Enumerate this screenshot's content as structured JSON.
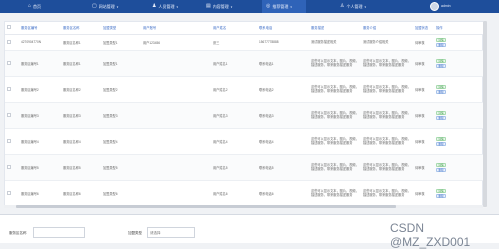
{
  "nav": [
    {
      "icon": "⌂",
      "label": "首页",
      "name": "home",
      "active": false
    },
    {
      "icon": "▢",
      "label": "网站管理",
      "name": "site-manage",
      "active": false
    },
    {
      "icon": "♟",
      "label": "人员管理",
      "name": "people-manage",
      "active": false
    },
    {
      "icon": "▤",
      "label": "内容管理",
      "name": "content-manage",
      "active": false
    },
    {
      "icon": "◎",
      "label": "推荐管理",
      "name": "recommend-manage",
      "active": true
    },
    {
      "icon": "♙",
      "label": "个人管理",
      "name": "personal-manage",
      "active": false
    }
  ],
  "user": {
    "name": "admin"
  },
  "table": {
    "headers": [
      "服务区编号",
      "服务区名称",
      "加盟类型",
      "用户账号",
      "用户姓名",
      "联系电话",
      "服务描述",
      "服务介绍",
      "加盟状态",
      "操作"
    ],
    "rows": [
      {
        "c": [
          "4270904770N",
          "服务区名称1",
          "加盟类型1",
          "用户123456",
          "张三",
          "15677778888",
          "测试服务描述相关",
          "测试服务介绍相关",
          "待审核"
        ]
      },
      {
        "c": [
          "服务区编号1",
          "服务区名称1",
          "加盟类型1",
          "",
          "用户姓名1",
          "联系电话1",
          "这些可以显示文本，图片，视频，描述服务，带来服务描述服务",
          "这些可以显示文本，图片，视频，描述服务，带来服务描述服务",
          "待审核"
        ]
      },
      {
        "c": [
          "服务区编号2",
          "服务区名称2",
          "加盟类型2",
          "",
          "用户姓名2",
          "联系电话2",
          "这些可以显示文本，图片，视频，描述服务，带来服务描述服务",
          "这些可以显示文本，图片，视频，描述服务，带来服务描述服务",
          "待审核"
        ]
      },
      {
        "c": [
          "服务区编号3",
          "服务区名称3",
          "加盟类型3",
          "",
          "用户姓名3",
          "联系电话3",
          "这些可以显示文本，图片，视频，描述服务，带来服务描述服务",
          "这些可以显示文本，图片，视频，描述服务，带来服务描述服务",
          "待审核"
        ]
      },
      {
        "c": [
          "服务区编号4",
          "服务区名称4",
          "加盟类型4",
          "",
          "用户姓名4",
          "联系电话4",
          "这些可以显示文本，图片，视频，描述服务，带来服务描述服务",
          "这些可以显示文本，图片，视频，描述服务，带来服务描述服务",
          "待审核"
        ]
      },
      {
        "c": [
          "服务区编号5",
          "服务区名称5",
          "加盟类型5",
          "",
          "用户姓名5",
          "联系电话5",
          "这些可以显示文本，图片，视频，描述服务，带来服务描述服务",
          "这些可以显示文本，图片，视频，描述服务，带来服务描述服务",
          "待审核"
        ]
      },
      {
        "c": [
          "服务区编号6",
          "服务区名称6",
          "加盟类型6",
          "",
          "用户姓名6",
          "联系电话6",
          "这些可以显示文本，图片，视频，描述服务，带来服务描述服务",
          "这些可以显示文本，图片，视频，描述服务，带来服务描述服务",
          "待审核"
        ]
      }
    ],
    "edit_label": "详情",
    "delete_label": "删除"
  },
  "form": {
    "name_label": "服务区名称",
    "name_value": "",
    "type_label": "加盟类型",
    "type_placeholder": "请选择"
  },
  "watermark": "CSDN @MZ_ZXD001",
  "colors": {
    "nav_bg": "#1e4e9b",
    "header_text": "#3a6bc6"
  }
}
